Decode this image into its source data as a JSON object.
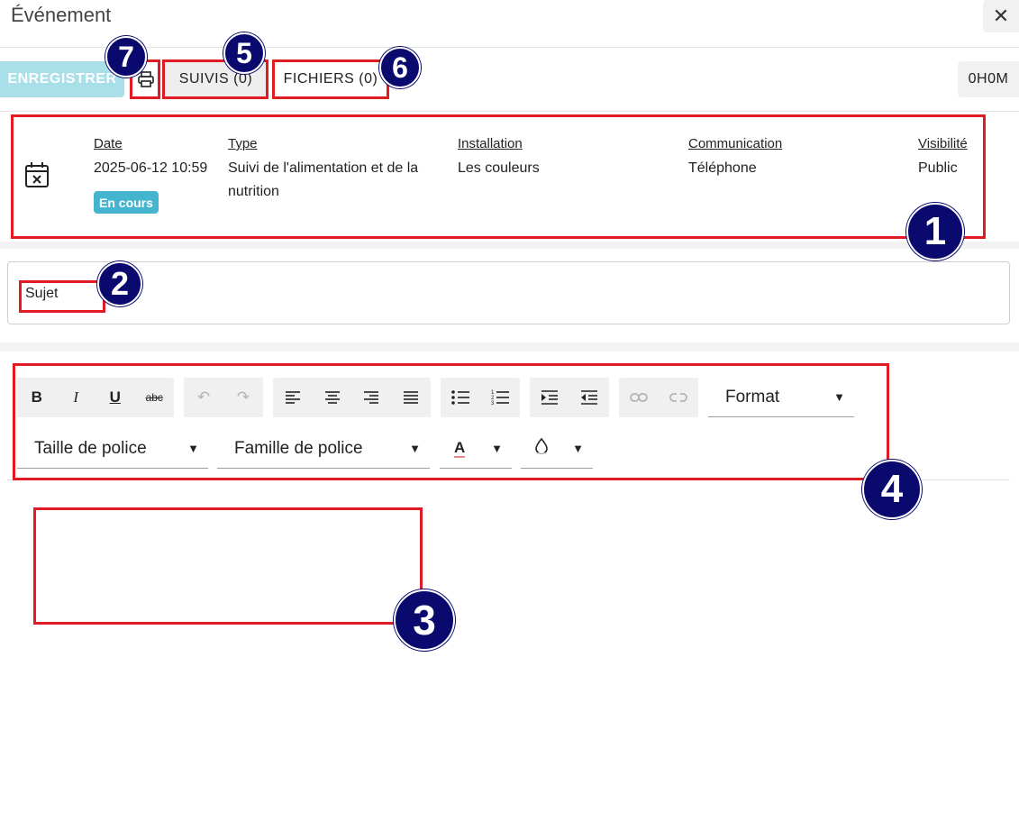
{
  "window": {
    "title": "Événement"
  },
  "toolbar": {
    "save_label": "ENREGISTRER",
    "suivis_label": "SUIVIS (0)",
    "fichiers_label": "FICHIERS (0)",
    "timer": "0H0M"
  },
  "event": {
    "status": "En cours",
    "columns": [
      {
        "label": "Date",
        "value": "2025-06-12 10:59"
      },
      {
        "label": "Type",
        "value": "Suivi de l'alimentation et de la nutrition"
      },
      {
        "label": "Installation",
        "value": "Les couleurs"
      },
      {
        "label": "Communication",
        "value": "Téléphone"
      },
      {
        "label": "Visibilité",
        "value": "Public"
      }
    ]
  },
  "subject": {
    "placeholder": "Sujet"
  },
  "editor": {
    "format_label": "Format",
    "font_size_label": "Taille de police",
    "font_family_label": "Famille de police",
    "text_color_glyph": "A",
    "body_text": ""
  },
  "annotations": [
    "1",
    "2",
    "3",
    "4",
    "5",
    "6",
    "7"
  ],
  "colors": {
    "accent": "#45b5cf",
    "save_button": "#a8dfe8",
    "annotation_box": "#e01b24",
    "annotation_marker": "#0a0a6e"
  }
}
